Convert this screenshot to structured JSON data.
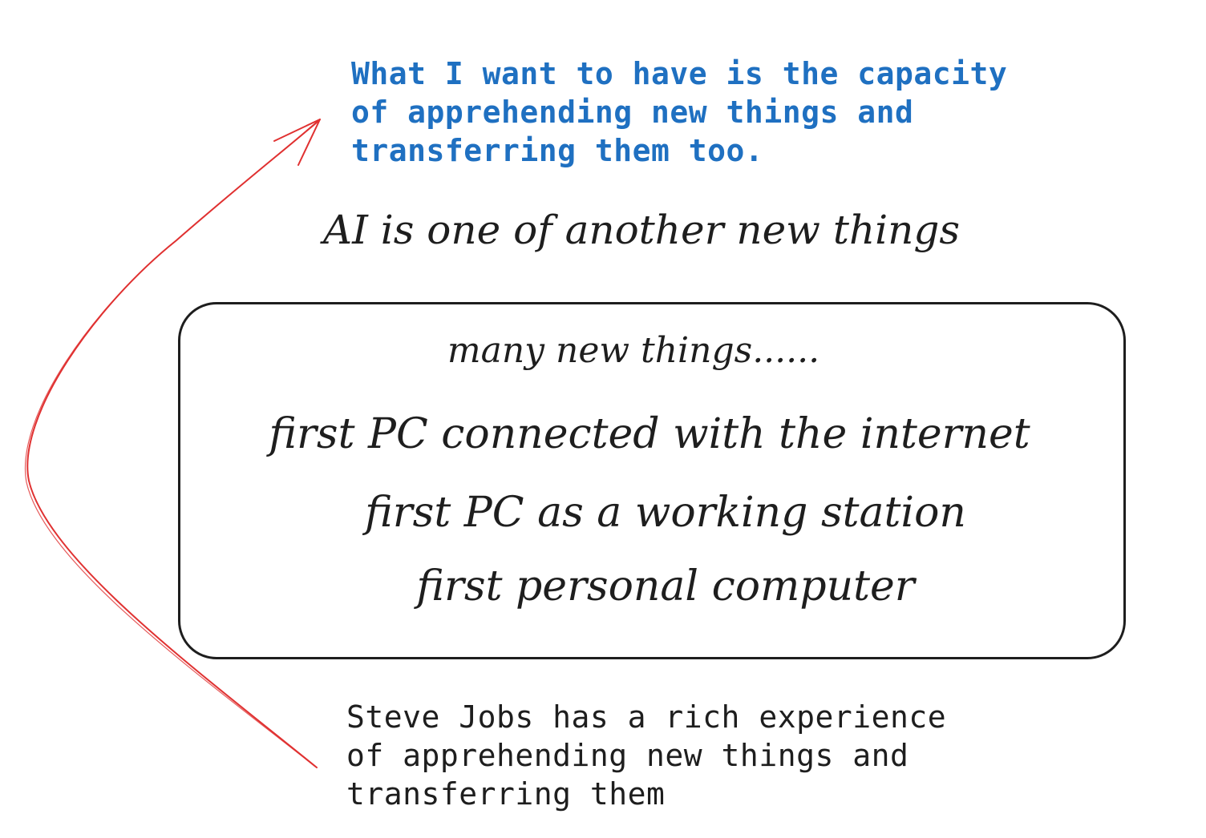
{
  "top_quote": {
    "lines": [
      "What I want to have is the capacity",
      "of apprehending new things and",
      "transferring them too."
    ],
    "color": "#1f70c1"
  },
  "headline": "AI is one of another new things",
  "box": {
    "title": "many new things......",
    "items": [
      "first PC connected with the internet",
      "first PC as a working station",
      "first personal computer"
    ]
  },
  "bottom_quote": {
    "lines": [
      "Steve Jobs has a rich experience",
      "of apprehending new things and",
      "transferring them"
    ],
    "color": "#1e1e1e"
  },
  "arrow": {
    "color": "#e03131"
  }
}
